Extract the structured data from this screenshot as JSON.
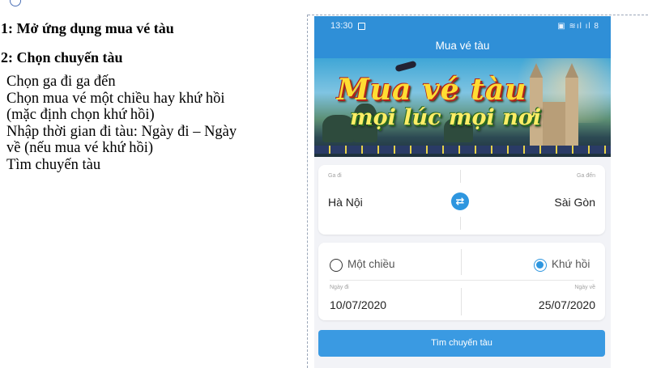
{
  "document": {
    "step1": "1: Mở ứng dụng mua vé tàu",
    "step2": "2: Chọn chuyến tàu",
    "lines": [
      "Chọn ga đi ga đến",
      "Chọn mua vé một chiều hay khứ hồi",
      "(mặc định chọn khứ hồi)",
      "Nhập thời gian đi tàu: Ngày đi – Ngày",
      "về (nếu mua vé khứ hồi)",
      "Tìm chuyến tàu"
    ]
  },
  "phone": {
    "status_time": "13:30",
    "app_title": "Mua vé tàu",
    "banner": {
      "line1": "Mua vé tàu",
      "line2": "mọi lúc mọi nơi"
    },
    "route": {
      "from_label": "Ga đi",
      "to_label": "Ga đến",
      "from_value": "Hà Nội",
      "to_value": "Sài Gòn",
      "swap_icon": "swap-arrows-icon"
    },
    "trip": {
      "one_way_label": "Một chiều",
      "round_trip_label": "Khứ hồi",
      "selected": "round_trip",
      "depart_label": "Ngày đi",
      "return_label": "Ngày về",
      "depart_value": "10/07/2020",
      "return_value": "25/07/2020"
    },
    "search_button": "Tìm chuyến tàu",
    "colors": {
      "primary": "#2f8fd7",
      "button": "#3a9ae2"
    }
  }
}
